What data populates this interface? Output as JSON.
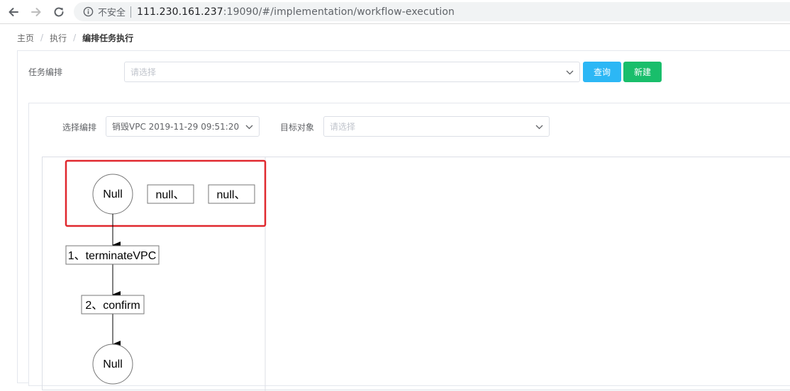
{
  "browser": {
    "security_label": "不安全",
    "url_host": "111.230.161.237",
    "url_rest": ":19090/#/implementation/workflow-execution"
  },
  "breadcrumb": {
    "items": [
      "主页",
      "执行",
      "编排任务执行"
    ],
    "separator": "/"
  },
  "task_form": {
    "label": "任务编排",
    "placeholder": "请选择",
    "query_button": "查询",
    "new_button": "新建"
  },
  "execution_form": {
    "workflow_label": "选择编排",
    "workflow_value": "销毁VPC 2019-11-29 09:51:20",
    "target_label": "目标对象",
    "target_placeholder": "请选择"
  },
  "diagram": {
    "start_node": "Null",
    "highlight_nodes": [
      "null、",
      "null、"
    ],
    "steps": [
      "1、terminateVPC",
      "2、confirm"
    ],
    "end_node": "Null",
    "highlight_color": "#e0282e"
  },
  "colors": {
    "query_button": "#2cb7f5",
    "new_button": "#19be6b"
  }
}
